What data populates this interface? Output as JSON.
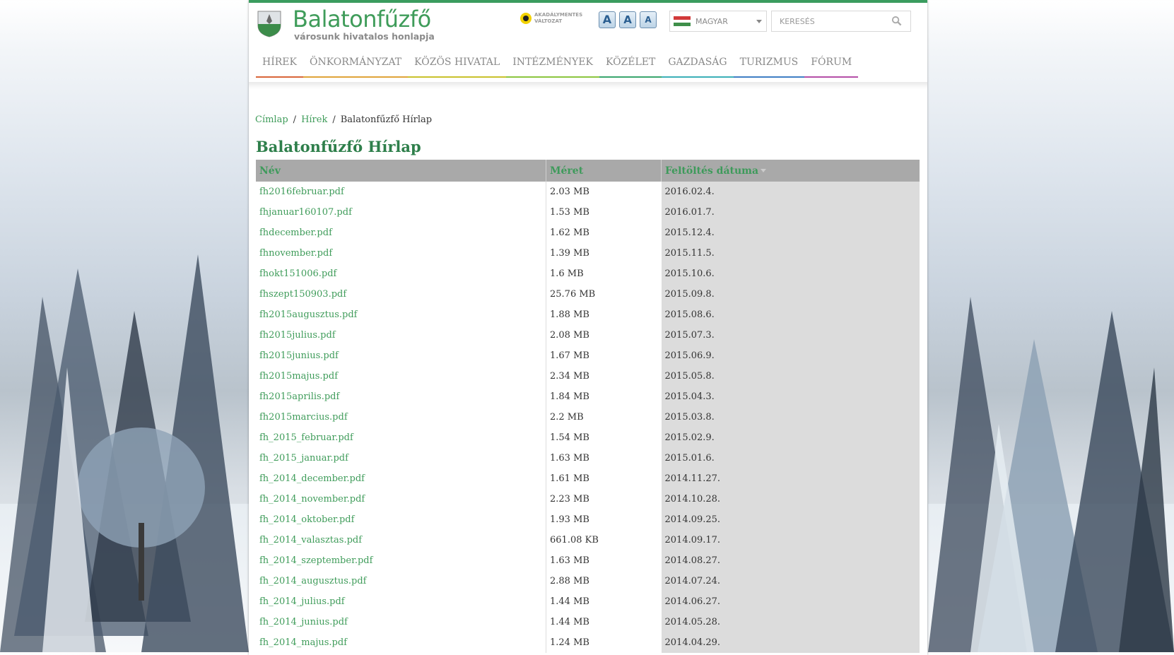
{
  "site": {
    "title": "Balatonfűzfő",
    "subtitle": "városunk hivatalos honlapja",
    "accessibility": [
      "AKADÁLYMENTES",
      "VÁLTOZAT"
    ],
    "font_buttons": [
      "A",
      "A",
      "A"
    ],
    "language": "MAGYAR",
    "search_placeholder": "KERESÉS"
  },
  "nav": [
    {
      "label": "HÍREK",
      "color": "#d9663a"
    },
    {
      "label": "ÖNKORMÁNYZAT",
      "color": "#e0a43a"
    },
    {
      "label": "KÖZÖS HIVATAL",
      "color": "#c9c22c"
    },
    {
      "label": "INTÉZMÉNYEK",
      "color": "#8cc63f"
    },
    {
      "label": "KÖZÉLET",
      "color": "#3aa66e"
    },
    {
      "label": "GAZDASÁG",
      "color": "#3bb0b8"
    },
    {
      "label": "TURIZMUS",
      "color": "#3f7fc4"
    },
    {
      "label": "FÓRUM",
      "color": "#b54fa8"
    }
  ],
  "breadcrumb": [
    "Címlap",
    "Hírek",
    "Balatonfűzfő Hírlap"
  ],
  "page_title": "Balatonfűzfő Hírlap",
  "table": {
    "headers": [
      "Név",
      "Méret",
      "Feltöltés dátuma"
    ],
    "rows": [
      [
        "fh2016februar.pdf",
        "2.03 MB",
        "2016.02.4."
      ],
      [
        "fhjanuar160107.pdf",
        "1.53 MB",
        "2016.01.7."
      ],
      [
        "fhdecember.pdf",
        "1.62 MB",
        "2015.12.4."
      ],
      [
        "fhnovember.pdf",
        "1.39 MB",
        "2015.11.5."
      ],
      [
        "fhokt151006.pdf",
        "1.6 MB",
        "2015.10.6."
      ],
      [
        "fhszept150903.pdf",
        "25.76 MB",
        "2015.09.8."
      ],
      [
        "fh2015augusztus.pdf",
        "1.88 MB",
        "2015.08.6."
      ],
      [
        "fh2015julius.pdf",
        "2.08 MB",
        "2015.07.3."
      ],
      [
        "fh2015junius.pdf",
        "1.67 MB",
        "2015.06.9."
      ],
      [
        "fh2015majus.pdf",
        "2.34 MB",
        "2015.05.8."
      ],
      [
        "fh2015aprilis.pdf",
        "1.84 MB",
        "2015.04.3."
      ],
      [
        "fh2015marcius.pdf",
        "2.2 MB",
        "2015.03.8."
      ],
      [
        "fh_2015_februar.pdf",
        "1.54 MB",
        "2015.02.9."
      ],
      [
        "fh_2015_januar.pdf",
        "1.63 MB",
        "2015.01.6."
      ],
      [
        "fh_2014_december.pdf",
        "1.61 MB",
        "2014.11.27."
      ],
      [
        "fh_2014_november.pdf",
        "2.23 MB",
        "2014.10.28."
      ],
      [
        "fh_2014_oktober.pdf",
        "1.93 MB",
        "2014.09.25."
      ],
      [
        "fh_2014_valasztas.pdf",
        "661.08 KB",
        "2014.09.17."
      ],
      [
        "fh_2014_szeptember.pdf",
        "1.63 MB",
        "2014.08.27."
      ],
      [
        "fh_2014_augusztus.pdf",
        "2.88 MB",
        "2014.07.24."
      ],
      [
        "fh_2014_julius.pdf",
        "1.44 MB",
        "2014.06.27."
      ],
      [
        "fh_2014_junius.pdf",
        "1.44 MB",
        "2014.05.28."
      ],
      [
        "fh_2014_majus.pdf",
        "1.24 MB",
        "2014.04.29."
      ]
    ]
  }
}
